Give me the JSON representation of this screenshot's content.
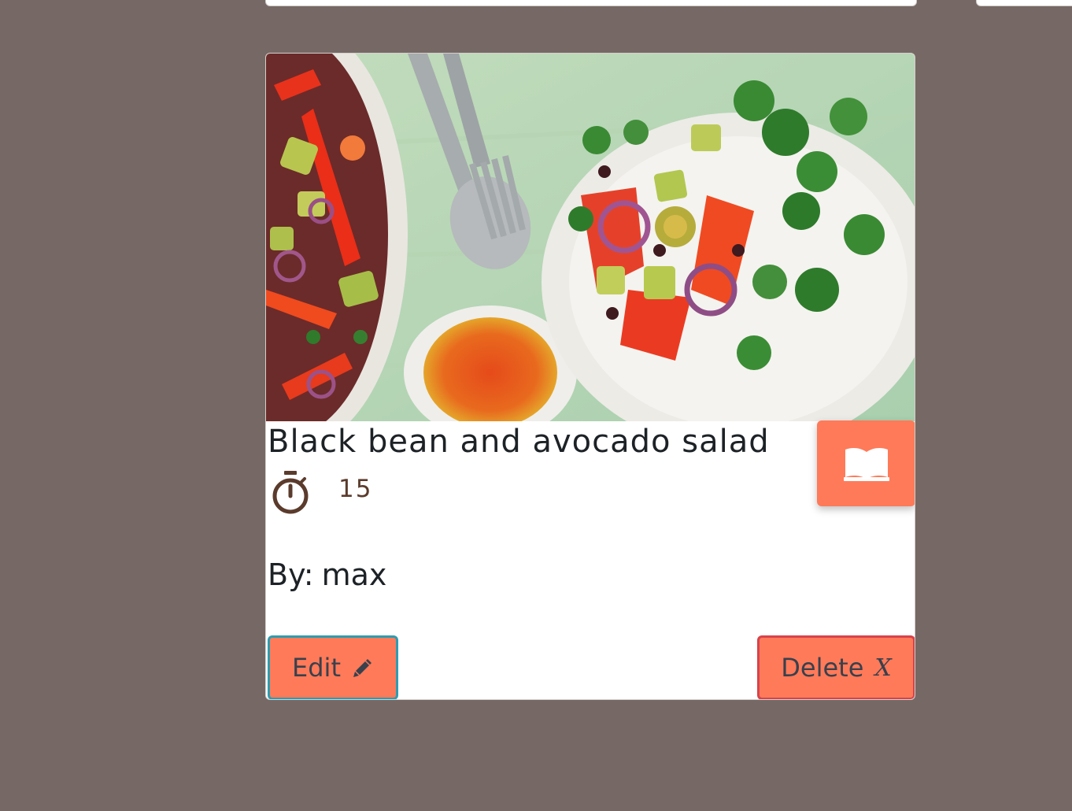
{
  "recipe": {
    "title": "Black bean and avocado salad",
    "time": "15",
    "author_prefix": "By:",
    "author": "max",
    "image_subject": "black bean and avocado salad in bowls with dressing and cutlery"
  },
  "actions": {
    "edit_label": "Edit",
    "edit_icon": "pencil-icon",
    "delete_label": "Delete",
    "delete_glyph": "X",
    "read_icon": "book-icon"
  },
  "colors": {
    "background": "#766864",
    "card": "#ffffff",
    "accent": "#ff7a59",
    "edit_border": "#2e9cb0",
    "delete_border": "#d8434a",
    "timer": "#5b3b2c",
    "text": "#1d2226"
  }
}
